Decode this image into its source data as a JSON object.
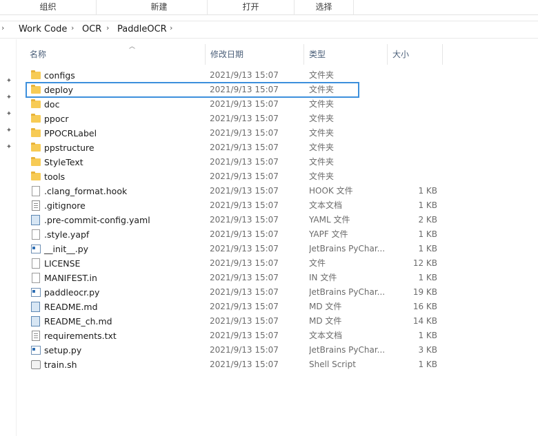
{
  "ribbon": {
    "groups": [
      "组织",
      "新建",
      "打开",
      "选择"
    ]
  },
  "breadcrumb": {
    "items": [
      "Work Code",
      "OCR",
      "PaddleOCR"
    ]
  },
  "columns": {
    "name": "名称",
    "date": "修改日期",
    "type": "类型",
    "size": "大小"
  },
  "files": [
    {
      "name": "configs",
      "date": "2021/9/13 15:07",
      "type": "文件夹",
      "size": "",
      "icon": "folder-icon"
    },
    {
      "name": "deploy",
      "date": "2021/9/13 15:07",
      "type": "文件夹",
      "size": "",
      "icon": "folder-icon"
    },
    {
      "name": "doc",
      "date": "2021/9/13 15:07",
      "type": "文件夹",
      "size": "",
      "icon": "folder-icon"
    },
    {
      "name": "ppocr",
      "date": "2021/9/13 15:07",
      "type": "文件夹",
      "size": "",
      "icon": "folder-icon"
    },
    {
      "name": "PPOCRLabel",
      "date": "2021/9/13 15:07",
      "type": "文件夹",
      "size": "",
      "icon": "folder-icon"
    },
    {
      "name": "ppstructure",
      "date": "2021/9/13 15:07",
      "type": "文件夹",
      "size": "",
      "icon": "folder-icon"
    },
    {
      "name": "StyleText",
      "date": "2021/9/13 15:07",
      "type": "文件夹",
      "size": "",
      "icon": "folder-icon"
    },
    {
      "name": "tools",
      "date": "2021/9/13 15:07",
      "type": "文件夹",
      "size": "",
      "icon": "folder-icon"
    },
    {
      "name": ".clang_format.hook",
      "date": "2021/9/13 15:07",
      "type": "HOOK 文件",
      "size": "1 KB",
      "icon": "file-icon"
    },
    {
      "name": ".gitignore",
      "date": "2021/9/13 15:07",
      "type": "文本文档",
      "size": "1 KB",
      "icon": "text-file-icon"
    },
    {
      "name": ".pre-commit-config.yaml",
      "date": "2021/9/13 15:07",
      "type": "YAML 文件",
      "size": "2 KB",
      "icon": "yaml-file-icon"
    },
    {
      "name": ".style.yapf",
      "date": "2021/9/13 15:07",
      "type": "YAPF 文件",
      "size": "1 KB",
      "icon": "file-icon"
    },
    {
      "name": "__init__.py",
      "date": "2021/9/13 15:07",
      "type": "JetBrains PyChar...",
      "size": "1 KB",
      "icon": "python-file-icon"
    },
    {
      "name": "LICENSE",
      "date": "2021/9/13 15:07",
      "type": "文件",
      "size": "12 KB",
      "icon": "file-icon"
    },
    {
      "name": "MANIFEST.in",
      "date": "2021/9/13 15:07",
      "type": "IN 文件",
      "size": "1 KB",
      "icon": "file-icon"
    },
    {
      "name": "paddleocr.py",
      "date": "2021/9/13 15:07",
      "type": "JetBrains PyChar...",
      "size": "19 KB",
      "icon": "python-file-icon"
    },
    {
      "name": "README.md",
      "date": "2021/9/13 15:07",
      "type": "MD 文件",
      "size": "16 KB",
      "icon": "markdown-file-icon"
    },
    {
      "name": "README_ch.md",
      "date": "2021/9/13 15:07",
      "type": "MD 文件",
      "size": "14 KB",
      "icon": "markdown-file-icon"
    },
    {
      "name": "requirements.txt",
      "date": "2021/9/13 15:07",
      "type": "文本文档",
      "size": "1 KB",
      "icon": "text-file-icon"
    },
    {
      "name": "setup.py",
      "date": "2021/9/13 15:07",
      "type": "JetBrains PyChar...",
      "size": "3 KB",
      "icon": "python-file-icon"
    },
    {
      "name": "train.sh",
      "date": "2021/9/13 15:07",
      "type": "Shell Script",
      "size": "1 KB",
      "icon": "shell-script-icon"
    }
  ],
  "selected_index": 1,
  "colors": {
    "selection_outline": "#3c8fdc",
    "folder": "#f7cb55",
    "header_text": "#4c607a"
  }
}
